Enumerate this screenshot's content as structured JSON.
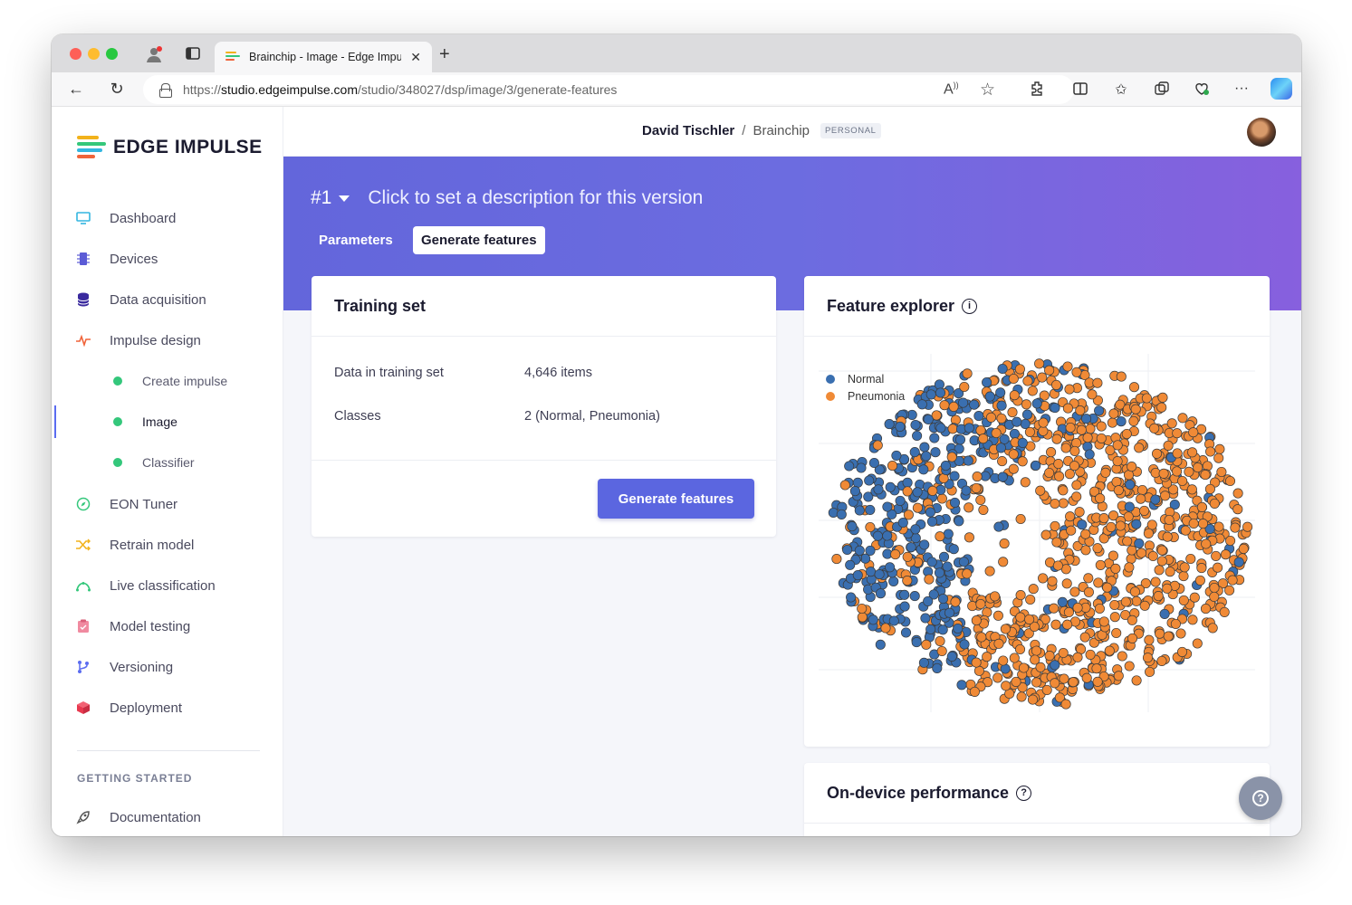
{
  "browser": {
    "tab_title": "Brainchip - Image - Edge Impu",
    "url_prefix": "https://",
    "url_host": "studio.edgeimpulse.com",
    "url_path": "/studio/348027/dsp/image/3/generate-features"
  },
  "logo": {
    "text": "EDGE IMPULSE"
  },
  "sidebar": {
    "items": [
      {
        "label": "Dashboard",
        "icon": "monitor-icon",
        "color": "#33b6e0"
      },
      {
        "label": "Devices",
        "icon": "chip-icon",
        "color": "#5b5bd6"
      },
      {
        "label": "Data acquisition",
        "icon": "database-icon",
        "color": "#3a2a9e"
      },
      {
        "label": "Impulse design",
        "icon": "pulse-icon",
        "color": "#f0643a"
      },
      {
        "label": "Create impulse",
        "sub": true
      },
      {
        "label": "Image",
        "sub": true,
        "active": true
      },
      {
        "label": "Classifier",
        "sub": true
      },
      {
        "label": "EON Tuner",
        "icon": "compass-icon",
        "color": "#34c77b"
      },
      {
        "label": "Retrain model",
        "icon": "shuffle-icon",
        "color": "#f2b21b"
      },
      {
        "label": "Live classification",
        "icon": "curve-icon",
        "color": "#34c77b"
      },
      {
        "label": "Model testing",
        "icon": "clipboard-icon",
        "color": "#f08aa0"
      },
      {
        "label": "Versioning",
        "icon": "branch-icon",
        "color": "#5b6cf0"
      },
      {
        "label": "Deployment",
        "icon": "cube-icon",
        "color": "#e8394f"
      }
    ],
    "section_title": "GETTING STARTED",
    "doc_label": "Documentation"
  },
  "header": {
    "user": "David Tischler",
    "separator": "/",
    "project": "Brainchip",
    "badge": "PERSONAL"
  },
  "version": {
    "number": "#1",
    "description": "Click to set a description for this version"
  },
  "tabs": {
    "parameters": "Parameters",
    "generate": "Generate features"
  },
  "training_set": {
    "title": "Training set",
    "rows": [
      {
        "label": "Data in training set",
        "value": "4,646 items"
      },
      {
        "label": "Classes",
        "value": "2 (Normal, Pneumonia)"
      }
    ],
    "button": "Generate features"
  },
  "feature_explorer": {
    "title": "Feature explorer",
    "info_icon": "info-icon",
    "legend": [
      {
        "name": "Normal",
        "color": "#3a6fb0"
      },
      {
        "name": "Pneumonia",
        "color": "#f08a36"
      }
    ]
  },
  "on_device": {
    "title": "On-device performance",
    "help_icon": "help-icon"
  },
  "help_fab": {
    "glyph": "?"
  }
}
